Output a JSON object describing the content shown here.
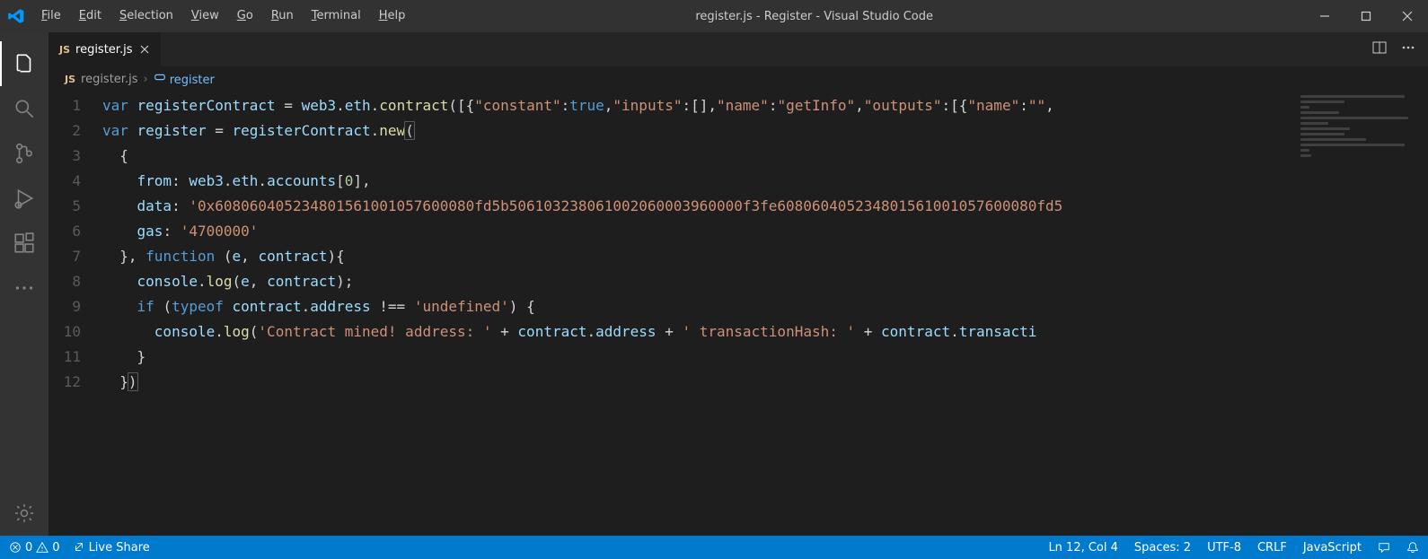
{
  "window": {
    "title": "register.js - Register - Visual Studio Code"
  },
  "menu": {
    "items": [
      "File",
      "Edit",
      "Selection",
      "View",
      "Go",
      "Run",
      "Terminal",
      "Help"
    ]
  },
  "tab": {
    "icon_label": "JS",
    "file_name": "register.js"
  },
  "breadcrumbs": {
    "icon_label": "JS",
    "file": "register.js",
    "symbol": "register"
  },
  "code": {
    "lines": [
      {
        "n": 1,
        "indent": 0,
        "tokens": [
          [
            "kw",
            "var"
          ],
          [
            "op",
            " "
          ],
          [
            "var",
            "registerContract"
          ],
          [
            "op",
            " = "
          ],
          [
            "var",
            "web3"
          ],
          [
            "pun",
            "."
          ],
          [
            "prop",
            "eth"
          ],
          [
            "pun",
            "."
          ],
          [
            "fn",
            "contract"
          ],
          [
            "pun",
            "(["
          ],
          [
            "pun",
            "{"
          ],
          [
            "str",
            "\"constant\""
          ],
          [
            "pun",
            ":"
          ],
          [
            "bool",
            "true"
          ],
          [
            "pun",
            ","
          ],
          [
            "str",
            "\"inputs\""
          ],
          [
            "pun",
            ":"
          ],
          [
            "pun",
            "[]"
          ],
          [
            "pun",
            ","
          ],
          [
            "str",
            "\"name\""
          ],
          [
            "pun",
            ":"
          ],
          [
            "str",
            "\"getInfo\""
          ],
          [
            "pun",
            ","
          ],
          [
            "str",
            "\"outputs\""
          ],
          [
            "pun",
            ":"
          ],
          [
            "pun",
            "[{"
          ],
          [
            "str",
            "\"name\""
          ],
          [
            "pun",
            ":"
          ],
          [
            "str",
            "\"\""
          ],
          [
            "pun",
            ","
          ]
        ]
      },
      {
        "n": 2,
        "indent": 0,
        "tokens": [
          [
            "kw",
            "var"
          ],
          [
            "op",
            " "
          ],
          [
            "var",
            "register"
          ],
          [
            "op",
            " = "
          ],
          [
            "var",
            "registerContract"
          ],
          [
            "pun",
            "."
          ],
          [
            "fn",
            "new"
          ],
          [
            "brhl",
            "("
          ]
        ]
      },
      {
        "n": 3,
        "indent": 1,
        "tokens": [
          [
            "pun",
            "{"
          ]
        ]
      },
      {
        "n": 4,
        "indent": 2,
        "tokens": [
          [
            "prop",
            "from"
          ],
          [
            "pun",
            ":"
          ],
          [
            "op",
            " "
          ],
          [
            "var",
            "web3"
          ],
          [
            "pun",
            "."
          ],
          [
            "prop",
            "eth"
          ],
          [
            "pun",
            "."
          ],
          [
            "prop",
            "accounts"
          ],
          [
            "pun",
            "["
          ],
          [
            "num",
            "0"
          ],
          [
            "pun",
            "],"
          ]
        ]
      },
      {
        "n": 5,
        "indent": 2,
        "tokens": [
          [
            "prop",
            "data"
          ],
          [
            "pun",
            ":"
          ],
          [
            "op",
            " "
          ],
          [
            "str",
            "'0x608060405234801561001057600080fd5b506103238061002060003960000f3fe608060405234801561001057600080fd5"
          ]
        ]
      },
      {
        "n": 6,
        "indent": 2,
        "tokens": [
          [
            "prop",
            "gas"
          ],
          [
            "pun",
            ":"
          ],
          [
            "op",
            " "
          ],
          [
            "str",
            "'4700000'"
          ]
        ]
      },
      {
        "n": 7,
        "indent": 1,
        "tokens": [
          [
            "pun",
            "},"
          ],
          [
            "op",
            " "
          ],
          [
            "kw2",
            "function"
          ],
          [
            "op",
            " "
          ],
          [
            "pun",
            "("
          ],
          [
            "var",
            "e"
          ],
          [
            "pun",
            ","
          ],
          [
            "op",
            " "
          ],
          [
            "var",
            "contract"
          ],
          [
            "pun",
            "){"
          ]
        ]
      },
      {
        "n": 8,
        "indent": 2,
        "tokens": [
          [
            "var",
            "console"
          ],
          [
            "pun",
            "."
          ],
          [
            "fn",
            "log"
          ],
          [
            "pun",
            "("
          ],
          [
            "var",
            "e"
          ],
          [
            "pun",
            ","
          ],
          [
            "op",
            " "
          ],
          [
            "var",
            "contract"
          ],
          [
            "pun",
            ");"
          ]
        ]
      },
      {
        "n": 9,
        "indent": 2,
        "tokens": [
          [
            "kw",
            "if"
          ],
          [
            "op",
            " "
          ],
          [
            "pun",
            "("
          ],
          [
            "kw2",
            "typeof"
          ],
          [
            "op",
            " "
          ],
          [
            "var",
            "contract"
          ],
          [
            "pun",
            "."
          ],
          [
            "prop",
            "address"
          ],
          [
            "op",
            " !== "
          ],
          [
            "str",
            "'undefined'"
          ],
          [
            "pun",
            ")"
          ],
          [
            "op",
            " "
          ],
          [
            "pun",
            "{"
          ]
        ]
      },
      {
        "n": 10,
        "indent": 3,
        "tokens": [
          [
            "var",
            "console"
          ],
          [
            "pun",
            "."
          ],
          [
            "fn",
            "log"
          ],
          [
            "pun",
            "("
          ],
          [
            "str",
            "'Contract mined! address: '"
          ],
          [
            "op",
            " + "
          ],
          [
            "var",
            "contract"
          ],
          [
            "pun",
            "."
          ],
          [
            "prop",
            "address"
          ],
          [
            "op",
            " + "
          ],
          [
            "str",
            "' transactionHash: '"
          ],
          [
            "op",
            " + "
          ],
          [
            "var",
            "contract"
          ],
          [
            "pun",
            "."
          ],
          [
            "prop",
            "transacti"
          ]
        ]
      },
      {
        "n": 11,
        "indent": 2,
        "tokens": [
          [
            "pun",
            "}"
          ]
        ]
      },
      {
        "n": 12,
        "indent": 1,
        "tokens": [
          [
            "pun",
            "}"
          ],
          [
            "brhl",
            ")"
          ]
        ]
      }
    ]
  },
  "status": {
    "errors": "0",
    "warnings": "0",
    "live_share": "Live Share",
    "ln_col": "Ln 12, Col 4",
    "spaces": "Spaces: 2",
    "encoding": "UTF-8",
    "eol": "CRLF",
    "language": "JavaScript"
  }
}
